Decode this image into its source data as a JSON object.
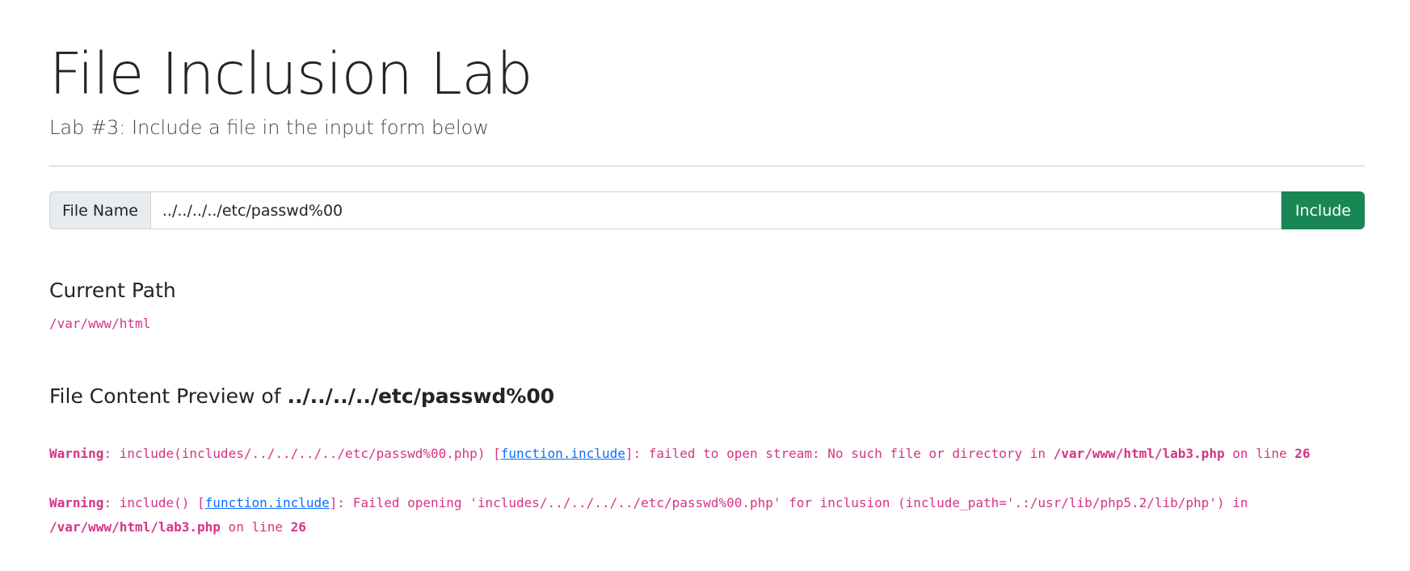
{
  "header": {
    "title": "File Inclusion Lab",
    "subtitle": "Lab #3: Include a file in the input form below"
  },
  "form": {
    "addon_label": "File Name",
    "input_value": "../../../../etc/passwd%00",
    "submit_label": "Include"
  },
  "current_path": {
    "heading": "Current Path",
    "value": "/var/www/html"
  },
  "preview": {
    "heading_prefix": "File Content Preview of",
    "heading_file": "../../../../etc/passwd%00"
  },
  "warnings": [
    {
      "label": "Warning",
      "pre": ": include(includes/../../../../etc/passwd%00.php) [",
      "link": "function.include",
      "post": "]: failed to open stream: No such file or directory in ",
      "file": "/var/www/html/lab3.php",
      "on_line": " on line ",
      "line": "26"
    },
    {
      "label": "Warning",
      "pre": ": include() [",
      "link": "function.include",
      "post": "]: Failed opening 'includes/../../../../etc/passwd%00.php' for inclusion (include_path='.:/usr/lib/php5.2/lib/php') in ",
      "file": "/var/www/html/lab3.php",
      "on_line": " on line ",
      "line": "26"
    }
  ],
  "colors": {
    "accent_button": "#198754",
    "code_text": "#d63384",
    "link": "#0d6efd"
  }
}
